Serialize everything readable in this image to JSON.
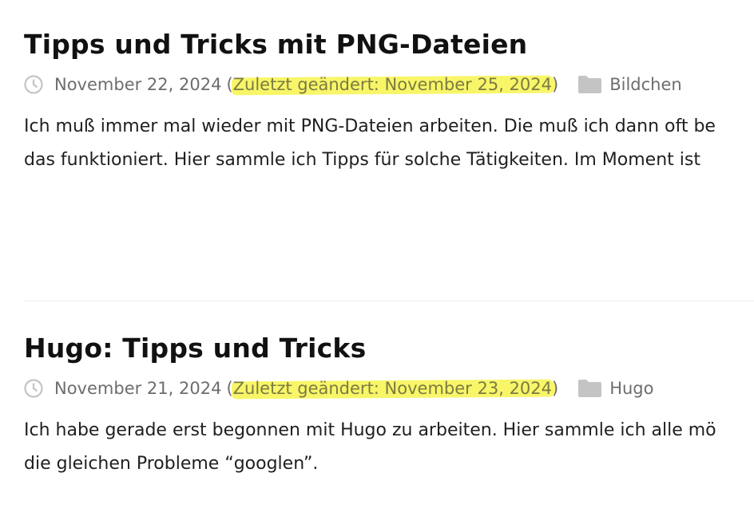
{
  "posts": [
    {
      "title": "Tipps und Tricks mit PNG-Dateien",
      "date": "November 22, 2024",
      "open_paren": "(",
      "updated": "Zuletzt geändert: November 25, 2024",
      "close_paren": ")",
      "category": "Bildchen",
      "excerpt_lines": [
        "Ich muß immer mal wieder mit PNG-Dateien arbeiten. Die muß ich dann oft be",
        "das funktioniert. Hier sammle ich Tipps für solche Tätigkeiten. Im Moment ist"
      ]
    },
    {
      "title": "Hugo: Tipps und Tricks",
      "date": "November 21, 2024",
      "open_paren": "(",
      "updated": "Zuletzt geändert: November 23, 2024",
      "close_paren": ")",
      "category": "Hugo",
      "excerpt_lines": [
        "Ich habe gerade erst begonnen mit Hugo zu arbeiten. Hier sammle ich alle mö",
        "die gleichen Probleme “googlen”."
      ]
    }
  ],
  "icons": {
    "date": "clock-icon",
    "category": "folder-icon"
  },
  "colors": {
    "highlight": "#f8f560",
    "meta_text": "#6d6d6d",
    "icon_gray": "#c4c4c4"
  }
}
